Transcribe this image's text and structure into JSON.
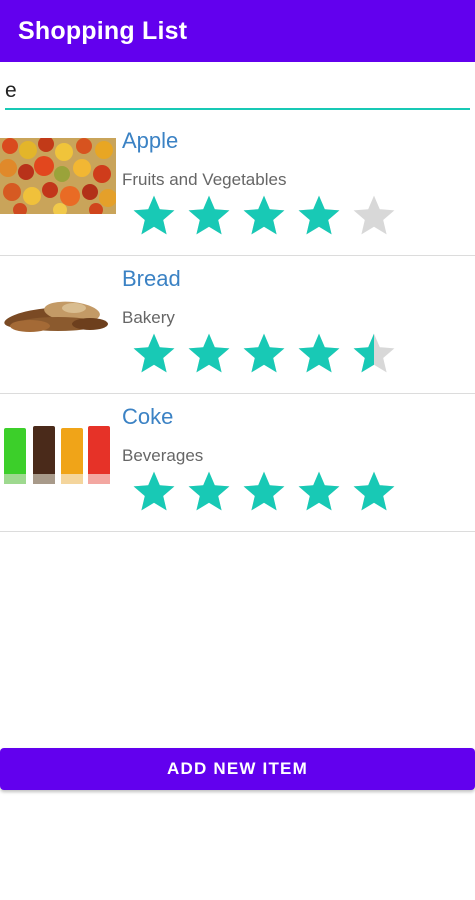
{
  "app": {
    "title": "Shopping List"
  },
  "search": {
    "value": "e",
    "placeholder": ""
  },
  "colors": {
    "brand": "#6200ee",
    "accent": "#18c9b5",
    "star_empty": "#d8d8d8",
    "title_text": "#3b82c4"
  },
  "items": [
    {
      "name": "Apple",
      "category": "Fruits and Vegetables",
      "rating": 4,
      "rating_max": 5,
      "image": "fruits-vegetables-photo"
    },
    {
      "name": "Bread",
      "category": "Bakery",
      "rating": 4.5,
      "rating_max": 5,
      "image": "bread-photo"
    },
    {
      "name": "Coke",
      "category": "Beverages",
      "rating": 5,
      "rating_max": 5,
      "image": "soda-glasses-photo"
    }
  ],
  "footer": {
    "add_button_label": "ADD NEW ITEM"
  }
}
